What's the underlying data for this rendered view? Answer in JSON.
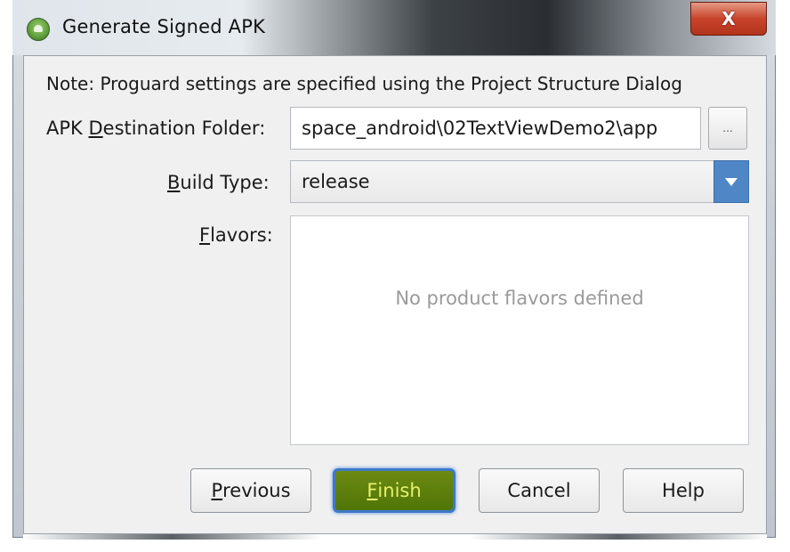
{
  "window": {
    "title": "Generate Signed APK",
    "close_label": "X"
  },
  "note": "Note: Proguard settings are specified using the Project Structure Dialog",
  "fields": {
    "destination": {
      "label_pre": "APK ",
      "label_mnemonic": "D",
      "label_post": "estination Folder:",
      "value": "space_android\\02TextViewDemo2\\app",
      "browse_label": "..."
    },
    "build_type": {
      "label_mnemonic": "B",
      "label_post": "uild Type:",
      "value": "release"
    },
    "flavors": {
      "label_mnemonic": "F",
      "label_post": "lavors:",
      "empty_message": "No product flavors defined"
    }
  },
  "buttons": {
    "previous": {
      "mnemonic": "P",
      "rest": "revious"
    },
    "finish": {
      "mnemonic": "F",
      "rest": "inish"
    },
    "cancel": {
      "label": "Cancel"
    },
    "help": {
      "label": "Help"
    }
  },
  "colors": {
    "accent_blue": "#4f86c6",
    "finish_bg": "#5f800e",
    "finish_text": "#e7f06a",
    "close_red": "#c8442b"
  }
}
